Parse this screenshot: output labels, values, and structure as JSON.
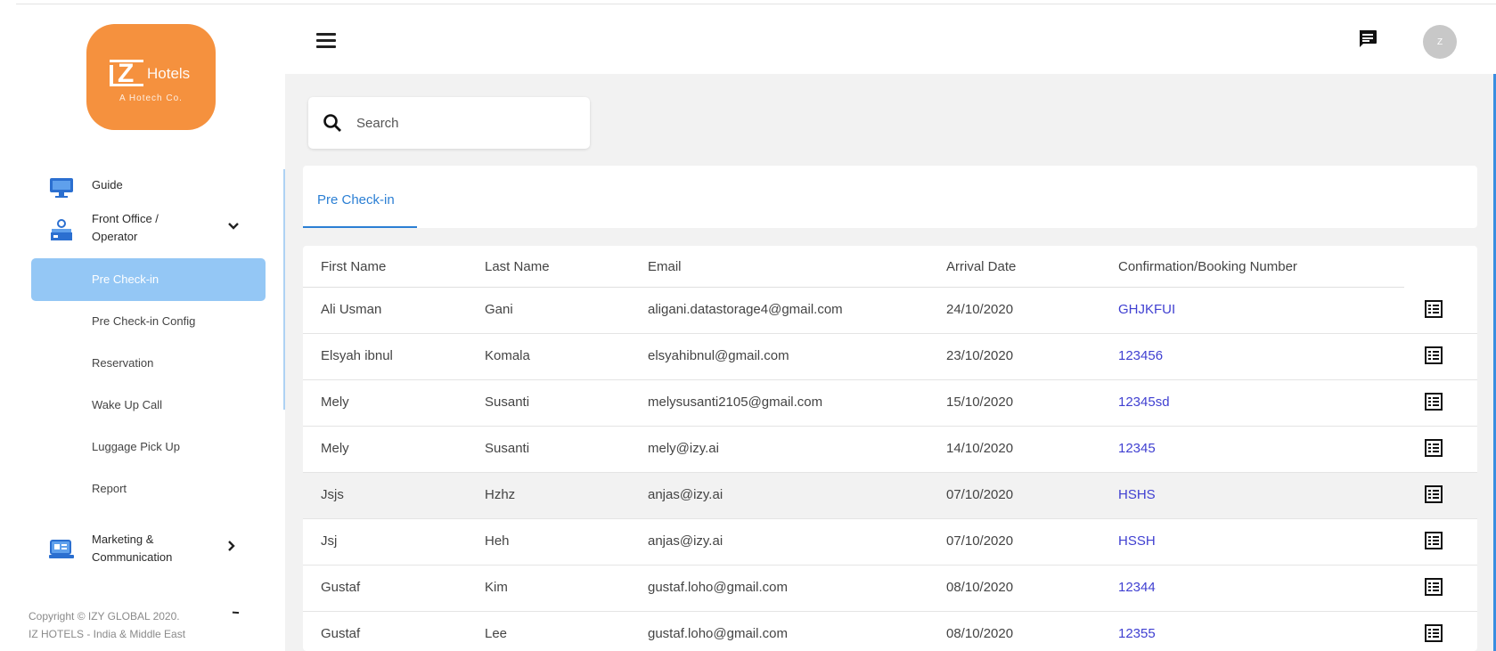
{
  "brand": {
    "word": "Hotels",
    "letter": "Z",
    "tagline": "A Hotech Co."
  },
  "sidebar": {
    "items": [
      {
        "label": "Guide",
        "icon": "monitor-icon"
      },
      {
        "label": "Front Office / Operator",
        "icon": "front-desk-icon"
      },
      {
        "label": "Marketing & Communication",
        "icon": "marketing-icon"
      }
    ],
    "front_office_label_1": "Front Office /",
    "front_office_label_2": "Operator",
    "marketing_label_1": "Marketing &",
    "marketing_label_2": "Communication",
    "subitems": [
      "Pre Check-in",
      "Pre Check-in Config",
      "Reservation",
      "Wake Up Call",
      "Luggage Pick Up",
      "Report"
    ],
    "active_subitem": "Pre Check-in",
    "copyright_1": "Copyright © IZY GLOBAL 2020.",
    "copyright_2": "IZ HOTELS - India & Middle East"
  },
  "header": {
    "avatar_initial": "Z",
    "menu_icon": "hamburger-icon",
    "chat_icon": "chat-icon"
  },
  "search": {
    "placeholder": "Search"
  },
  "tabs": [
    {
      "label": "Pre Check-in",
      "active": true
    }
  ],
  "table": {
    "columns": [
      "First Name",
      "Last Name",
      "Email",
      "Arrival Date",
      "Confirmation/Booking Number"
    ],
    "rows": [
      [
        "Ali Usman",
        "Gani",
        "aligani.datastorage4@gmail.com",
        "24/10/2020",
        "GHJKFUI"
      ],
      [
        "Elsyah ibnul",
        "Komala",
        "elsyahibnul@gmail.com",
        "23/10/2020",
        "123456"
      ],
      [
        "Mely",
        "Susanti",
        "melysusanti2105@gmail.com",
        "15/10/2020",
        "12345sd"
      ],
      [
        "Mely",
        "Susanti",
        "mely@izy.ai",
        "14/10/2020",
        "12345"
      ],
      [
        "Jsjs",
        "Hzhz",
        "anjas@izy.ai",
        "07/10/2020",
        "HSHS"
      ],
      [
        "Jsj",
        "Heh",
        "anjas@izy.ai",
        "07/10/2020",
        "HSSH"
      ],
      [
        "Gustaf",
        "Kim",
        "gustaf.loho@gmail.com",
        "08/10/2020",
        "12344"
      ],
      [
        "Gustaf",
        "Lee",
        "gustaf.loho@gmail.com",
        "08/10/2020",
        "12355"
      ]
    ],
    "highlighted_row": 4,
    "row_action_icon": "details-list-icon"
  },
  "colors": {
    "accent": "#2b7fd4",
    "brand": "#f5913e",
    "active_nav": "#94c7f5",
    "link": "#3f3fd1"
  }
}
